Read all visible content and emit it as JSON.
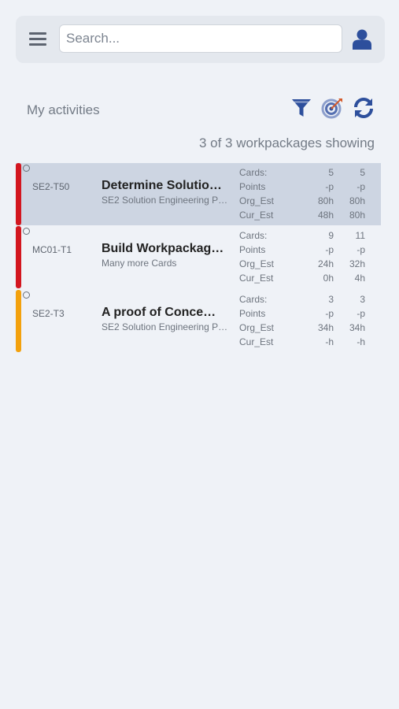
{
  "search": {
    "placeholder": "Search..."
  },
  "header": {
    "title": "My activities",
    "showing": "3 of 3 workpackages showing"
  },
  "colors": {
    "accent": "#2d4f9c",
    "selected_bg": "#cdd5e2",
    "status_red": "#d3161f",
    "status_orange": "#f3a10d"
  },
  "icons": [
    "menu-icon",
    "user-icon",
    "filter-icon",
    "target-icon",
    "refresh-icon"
  ],
  "workpackages": [
    {
      "id": "SE2-T50",
      "title": "Determine Solution",
      "title_display": "Determine Solutio…",
      "subtitle": "SE2 Solution Engineering P…",
      "status_color": "#d3161f",
      "selected": true,
      "stats": [
        {
          "label": "Cards:",
          "v1": "5",
          "v2": "5"
        },
        {
          "label": "Points",
          "v1": "-p",
          "v2": "-p"
        },
        {
          "label": "Org_Est",
          "v1": "80h",
          "v2": "80h"
        },
        {
          "label": "Cur_Est",
          "v1": "48h",
          "v2": "80h"
        }
      ]
    },
    {
      "id": "MC01-T1",
      "title": "Build Workpackage",
      "title_display": "Build Workpackag…",
      "subtitle": "Many more Cards",
      "status_color": "#d3161f",
      "selected": false,
      "stats": [
        {
          "label": "Cards:",
          "v1": "9",
          "v2": "11"
        },
        {
          "label": "Points",
          "v1": "-p",
          "v2": "-p"
        },
        {
          "label": "Org_Est",
          "v1": "24h",
          "v2": "32h"
        },
        {
          "label": "Cur_Est",
          "v1": "0h",
          "v2": "4h"
        }
      ]
    },
    {
      "id": "SE2-T3",
      "title": "A proof of Concept",
      "title_display": " A proof of Conce…",
      "subtitle": "SE2 Solution Engineering P…",
      "status_color": "#f3a10d",
      "selected": false,
      "stats": [
        {
          "label": "Cards:",
          "v1": "3",
          "v2": "3"
        },
        {
          "label": "Points",
          "v1": "-p",
          "v2": "-p"
        },
        {
          "label": "Org_Est",
          "v1": "34h",
          "v2": "34h"
        },
        {
          "label": "Cur_Est",
          "v1": "-h",
          "v2": "-h"
        }
      ]
    }
  ]
}
